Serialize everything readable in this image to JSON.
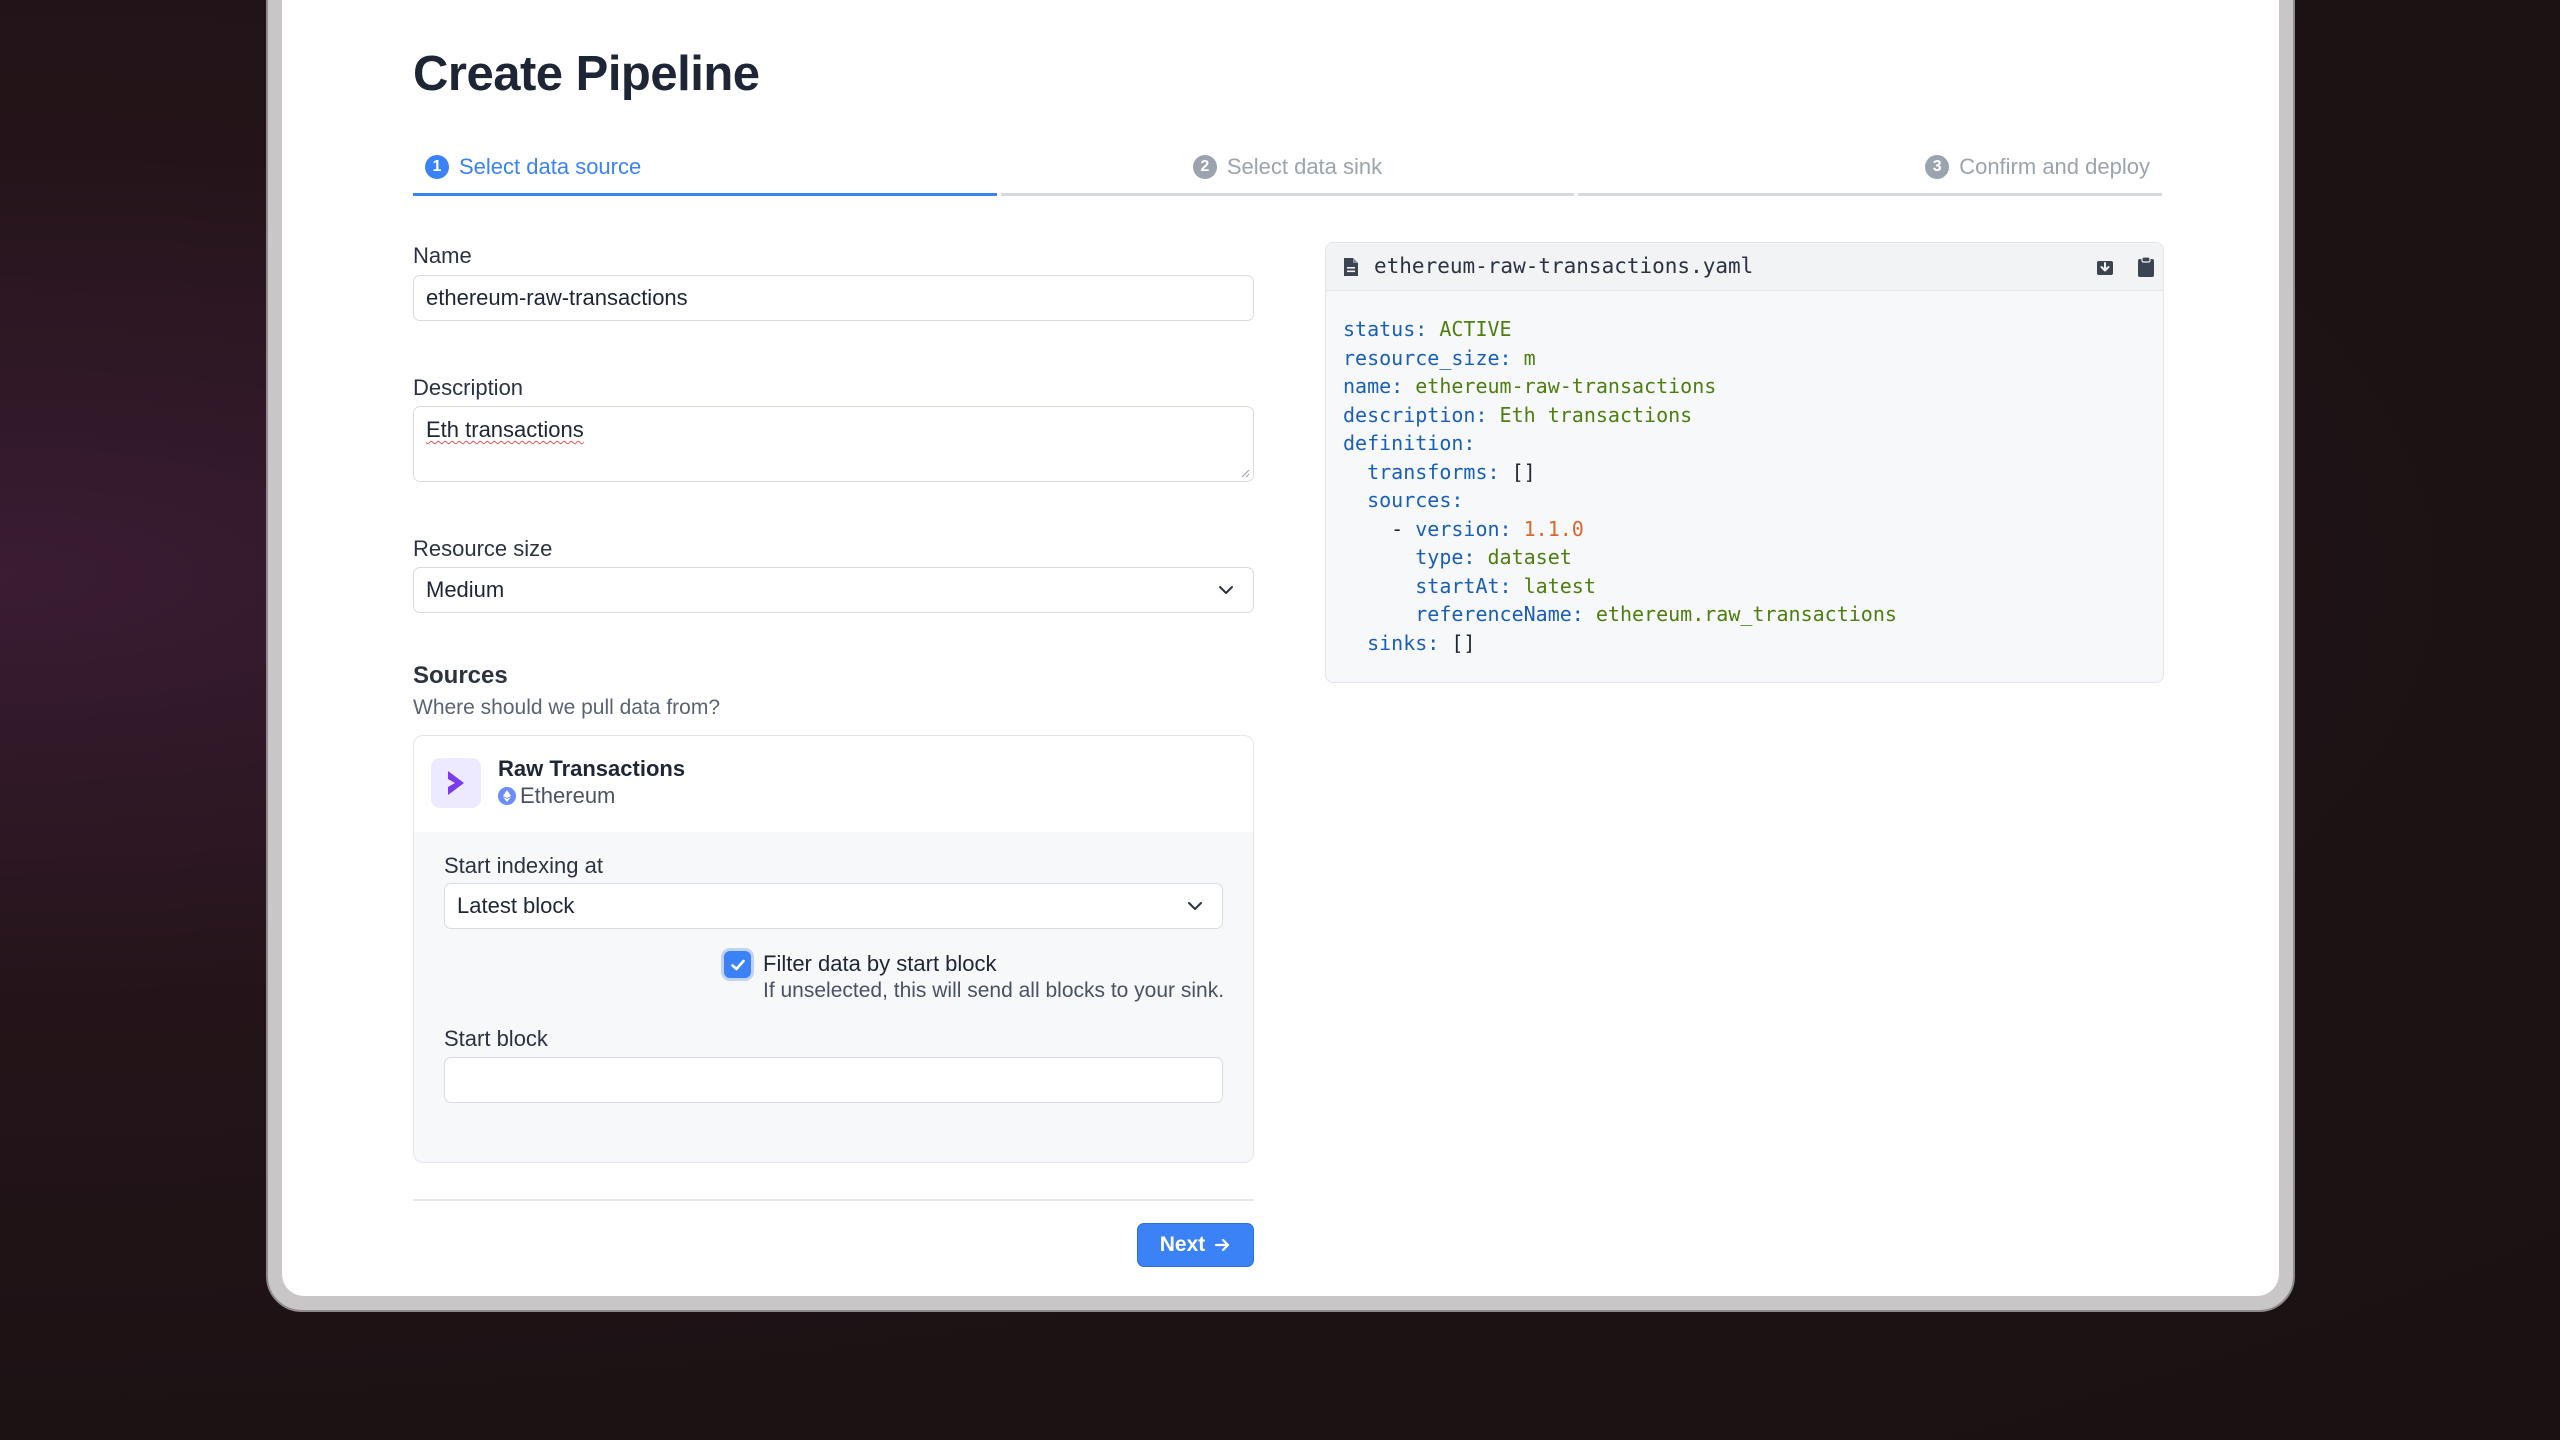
{
  "page": {
    "title": "Create Pipeline"
  },
  "stepper": {
    "steps": [
      {
        "num": "1",
        "label": "Select data source"
      },
      {
        "num": "2",
        "label": "Select data sink"
      },
      {
        "num": "3",
        "label": "Confirm and deploy"
      }
    ]
  },
  "form": {
    "name_label": "Name",
    "name_value": "ethereum-raw-transactions",
    "description_label": "Description",
    "description_value": "Eth transactions",
    "resource_label": "Resource size",
    "resource_value": "Medium"
  },
  "sources": {
    "title": "Sources",
    "subtitle": "Where should we pull data from?",
    "card": {
      "name": "Raw Transactions",
      "chain": "Ethereum",
      "start_label": "Start indexing at",
      "start_value": "Latest block",
      "filter_label": "Filter data by start block",
      "filter_help": "If unselected, this will send all blocks to your sink.",
      "filter_checked": true,
      "start_block_label": "Start block",
      "start_block_value": ""
    }
  },
  "actions": {
    "next_label": "Next"
  },
  "yaml": {
    "filename": "ethereum-raw-transactions.yaml",
    "lines": [
      {
        "indent": "",
        "key": "status",
        "value": "ACTIVE",
        "type": "str"
      },
      {
        "indent": "",
        "key": "resource_size",
        "value": "m",
        "type": "str"
      },
      {
        "indent": "",
        "key": "name",
        "value": "ethereum-raw-transactions",
        "type": "str"
      },
      {
        "indent": "",
        "key": "description",
        "value": "Eth transactions",
        "type": "str"
      },
      {
        "indent": "",
        "key": "definition",
        "value": "",
        "type": "str"
      },
      {
        "indent": "  ",
        "key": "transforms",
        "value": "[]",
        "type": "punct"
      },
      {
        "indent": "  ",
        "key": "sources",
        "value": "",
        "type": "str"
      },
      {
        "indent": "    - ",
        "key": "version",
        "value": "1.1.0",
        "type": "num"
      },
      {
        "indent": "      ",
        "key": "type",
        "value": "dataset",
        "type": "str"
      },
      {
        "indent": "      ",
        "key": "startAt",
        "value": "latest",
        "type": "str"
      },
      {
        "indent": "      ",
        "key": "referenceName",
        "value": "ethereum.raw_transactions",
        "type": "str"
      },
      {
        "indent": "  ",
        "key": "sinks",
        "value": "[]",
        "type": "punct"
      }
    ]
  },
  "colors": {
    "accent": "#3b82f6",
    "yaml_key": "#1a5fb4",
    "yaml_string": "#4e7d10",
    "yaml_number": "#d9662c"
  }
}
